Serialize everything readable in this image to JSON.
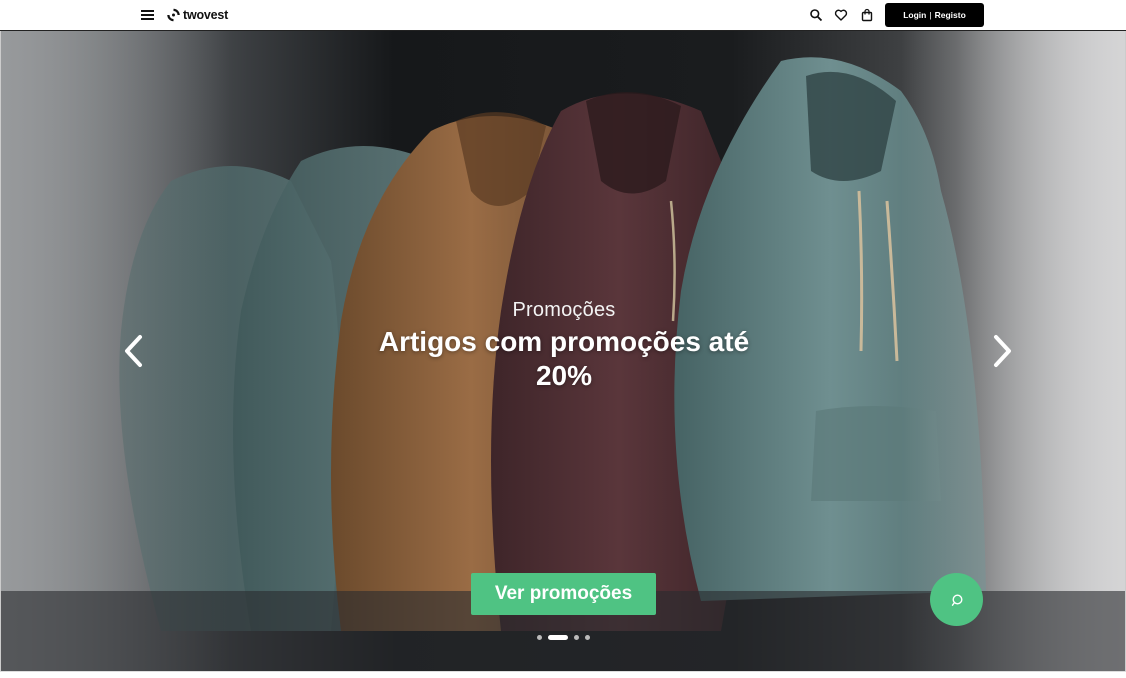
{
  "header": {
    "brand_name": "twovest",
    "login_label": "Login",
    "login_separator": "|",
    "register_label": "Registo",
    "icons": [
      "menu-icon",
      "logo-mark-icon",
      "search-icon",
      "heart-icon",
      "shopping-bag-icon"
    ]
  },
  "hero": {
    "subtitle": "Promoções",
    "title": "Artigos com promoções até 20%",
    "cta_label": "Ver promoções",
    "slide_count": 4,
    "active_slide": 2,
    "prev_icon": "chevron-left-icon",
    "next_icon": "chevron-right-icon"
  },
  "chat": {
    "icon": "chat-bubble-icon"
  },
  "colors": {
    "accent": "#4fc383",
    "header_bg": "#ffffff",
    "login_bg": "#000000",
    "text_light": "#ffffff"
  }
}
